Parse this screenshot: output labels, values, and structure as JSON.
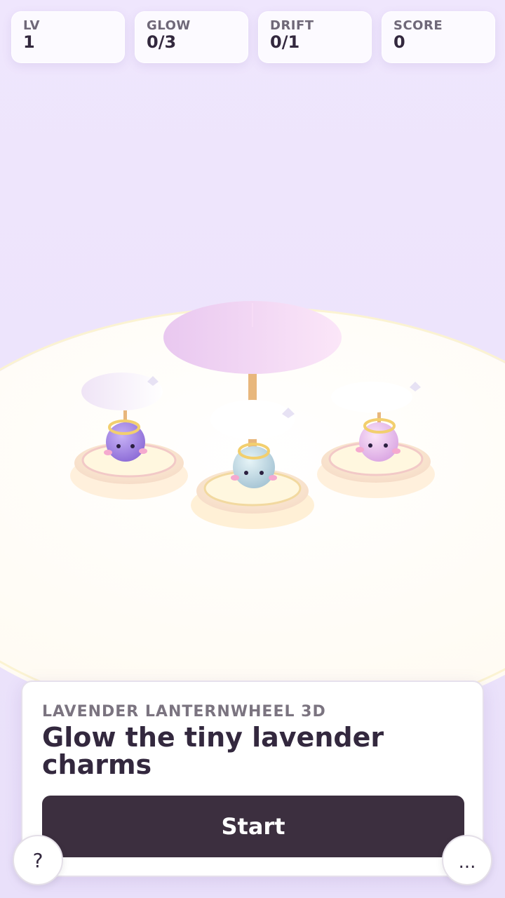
{
  "hud": [
    {
      "label": "LV",
      "value": "1"
    },
    {
      "label": "GLOW",
      "value": "0/3"
    },
    {
      "label": "DRIFT",
      "value": "0/1"
    },
    {
      "label": "SCORE",
      "value": "0"
    }
  ],
  "card": {
    "kicker": "LAVENDER LANTERNWHEEL 3D",
    "title": "Glow the tiny lavender charms",
    "start_label": "Start"
  },
  "buttons": {
    "help_label": "?",
    "more_label": "..."
  },
  "colors": {
    "background": "#efe6fd",
    "platform": "#fffdf9",
    "canopy_main": "#f2d2f5",
    "charm_purple": "#a88be8",
    "charm_blue": "#cfe6ef",
    "charm_pink": "#f0c8ee",
    "ring": "#f2cf6e",
    "button_dark": "#3c2f3f"
  }
}
